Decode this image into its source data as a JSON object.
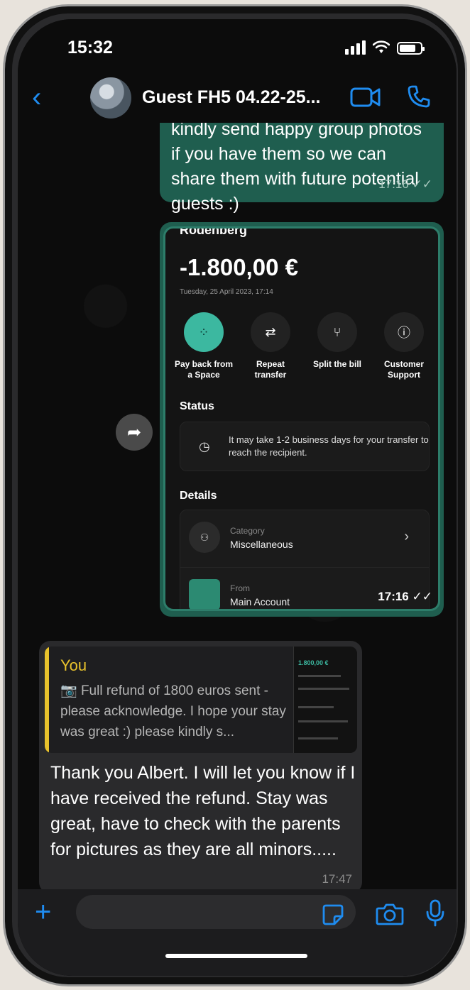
{
  "status_bar": {
    "time": "15:32"
  },
  "header": {
    "title": "Guest FH5 04.22-25..."
  },
  "messages": {
    "outgoing_text": {
      "text": "kindly send happy group photos if you have them so we can share them with future potential guests :)",
      "time": "17:16"
    },
    "outgoing_image": {
      "time": "17:16",
      "screenshot": {
        "merchant": "Rodenberg",
        "amount": "-1.800,00 €",
        "date": "Tuesday, 25 April 2023, 17:14",
        "actions": [
          {
            "label": "Pay back from a Space",
            "icon": "spaces-icon"
          },
          {
            "label": "Repeat transfer",
            "icon": "repeat-icon"
          },
          {
            "label": "Split the bill",
            "icon": "split-icon"
          },
          {
            "label": "Customer Support",
            "icon": "support-icon"
          }
        ],
        "status_title": "Status",
        "status_text": "It may take 1-2 business days for your transfer to reach the recipient.",
        "details_title": "Details",
        "details": [
          {
            "key": "Category",
            "value": "Miscellaneous"
          },
          {
            "key": "From",
            "value": "Main Account"
          }
        ]
      }
    },
    "incoming": {
      "quote_author": "You",
      "quote_text": "Full refund of 1800 euros sent - please acknowledge. I hope your stay was great :) please kindly s...",
      "thumb_amount": "1.800,00 €",
      "text": "Thank you Albert. I will let you know if I have received the refund. Stay was great, have to check with the parents for pictures as they are all minors.....",
      "time": "17:47"
    }
  },
  "colors": {
    "accent": "#1f8cf0",
    "outgoing_bubble": "#1f5e4f",
    "incoming_bubble": "#2a2a2c",
    "quote_bar": "#e8c22c",
    "brand_teal": "#3cb8a0"
  }
}
